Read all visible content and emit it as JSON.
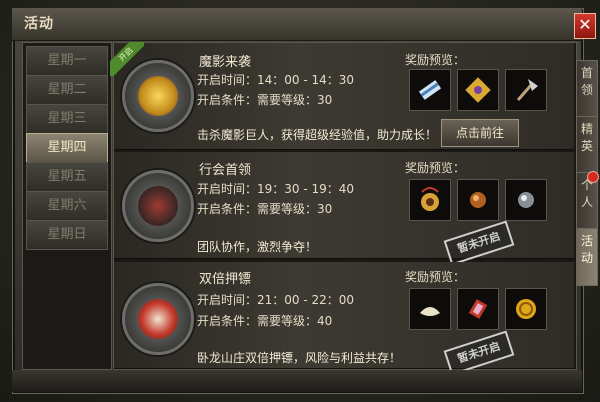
{
  "window": {
    "title": "活动",
    "close_label": "✕"
  },
  "days": [
    {
      "label": "星期一",
      "active": false
    },
    {
      "label": "星期二",
      "active": false
    },
    {
      "label": "星期三",
      "active": false
    },
    {
      "label": "星期四",
      "active": true
    },
    {
      "label": "星期五",
      "active": false
    },
    {
      "label": "星期六",
      "active": false
    },
    {
      "label": "星期日",
      "active": false
    }
  ],
  "right_tabs": [
    {
      "label": "首领",
      "active": false
    },
    {
      "label": "精英",
      "active": false
    },
    {
      "label": "个人",
      "active": false
    },
    {
      "label": "活动",
      "active": true
    }
  ],
  "events": [
    {
      "title": "魔影来袭",
      "time": "开启时间：14：00 - 14：30",
      "condition": "开启条件：需要等级：30",
      "description": "击杀魔影巨人，获得超级经验值，助力成长！",
      "reward_label": "奖励预览：",
      "rewards": [
        "scroll-icon",
        "gold-ornament-icon",
        "axe-icon"
      ],
      "action": "点击前往",
      "ribbon": "开启"
    },
    {
      "title": "行会首领",
      "time": "开启时间：19：30 - 19：40",
      "condition": "开启条件：需要等级：30",
      "description": "团队协作，激烈争夺！",
      "reward_label": "奖励预览：",
      "rewards": [
        "golden-gourd-icon",
        "copper-orb-icon",
        "silver-orb-icon"
      ],
      "stamp": "暂未开启"
    },
    {
      "title": "双倍押镖",
      "time": "开启时间：21：00 - 22：00",
      "condition": "开启条件：需要等级：40",
      "description": "卧龙山庄双倍押镖，风险与利益共存！",
      "reward_label": "奖励预览：",
      "rewards": [
        "silver-ingot-icon",
        "red-gem-icon",
        "gold-coin-icon"
      ],
      "stamp": "暂未开启"
    }
  ]
}
